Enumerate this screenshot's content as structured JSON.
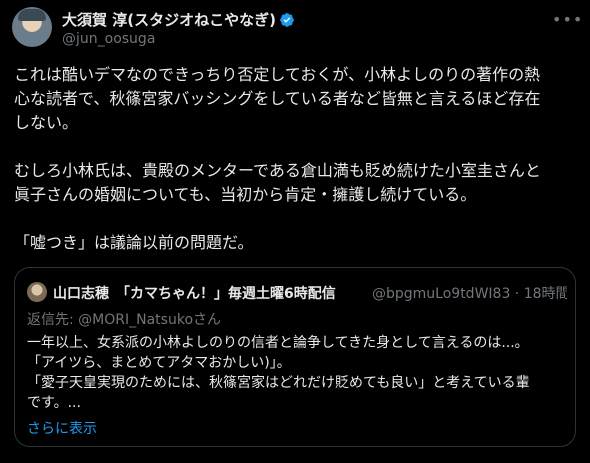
{
  "tweet": {
    "author_name": "大須賀 淳(スタジオねこやなぎ)",
    "author_handle": "@jun_oosuga",
    "verified": true,
    "more_icon": "more-horizontal-icon",
    "body": [
      "これは酷いデマなのできっちり否定しておくが、小林よしのりの著作の熱",
      "心な読者で、秋篠宮家バッシングをしている者など皆無と言えるほど存在",
      "しない。",
      "",
      "むしろ小林氏は、貴殿のメンターである倉山満も貶め続けた小室圭さんと",
      "眞子さんの婚姻についても、当初から肯定・擁護し続けている。",
      "",
      "「嘘つき」は議論以前の問題だ。"
    ]
  },
  "quoted_tweet": {
    "author_name": "山口志穂　「カマちゃん！」毎週土曜6時配信",
    "author_handle": "@bpgmuLo9tdWI83 · 18時間",
    "reply_prefix": "返信先: ",
    "reply_to": "@MORI_Natsukoさん",
    "body": [
      "一年以上、女系派の小林よしのりの信者と論争してきた身として言えるのは...。",
      "「アイツら、まとめてアタマおかしい)」。",
      "「愛子天皇実現のためには、秋篠宮家はどれだけ貶めても良い」と考えている輩",
      "です。..."
    ],
    "show_more": "さらに表示"
  },
  "colors": {
    "background": "#000000",
    "text": "#e7e9ea",
    "secondary": "#71767b",
    "accent": "#1d9bf0",
    "border": "#2f3336"
  }
}
